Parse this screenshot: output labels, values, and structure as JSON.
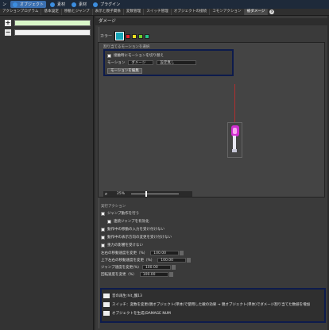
{
  "toolbar": {
    "items": [
      {
        "label": "ン",
        "active": false
      },
      {
        "label": "オブジェクト",
        "active": true
      },
      {
        "label": "素材",
        "active": false
      },
      {
        "label": "素材",
        "active": false
      },
      {
        "label": "プラグイン",
        "active": false
      }
    ]
  },
  "tabs": [
    {
      "label": "アクションプログラム",
      "active": false
    },
    {
      "label": "基本設定",
      "active": false
    },
    {
      "label": "移動とジャンプ",
      "active": false
    },
    {
      "label": "表示と親子関係",
      "active": false
    },
    {
      "label": "変数管理",
      "active": false
    },
    {
      "label": "スイッチ管理",
      "active": false
    },
    {
      "label": "オブジェクトの接続",
      "active": false
    },
    {
      "label": "コモンアクション",
      "active": false
    },
    {
      "label": "被ダメージ",
      "active": true
    }
  ],
  "left_panel": {
    "add_symbol": "+",
    "remove_symbol": "−"
  },
  "main": {
    "header": "ダメージ",
    "color_label": "カラー",
    "colors": [
      "#19a6b8",
      "#e8202a",
      "#f3e021",
      "#6fd12a",
      "#24c48a"
    ],
    "motion_section_title": "割り当てるモーションを選択",
    "motion": {
      "checkbox_label": "接触時にモーションを切り替え",
      "motion_label": "モーション",
      "motion_value": "ダメージ",
      "motion_setting": "設定無し",
      "edit_button": "モーションを編集"
    },
    "zoom": {
      "icon": "magnifier-icon",
      "value": "25%"
    },
    "actions_title": "実行アクション",
    "actions": [
      {
        "type": "check",
        "label": "ジャンプ動作を行う"
      },
      {
        "type": "check",
        "label": "連続ジャンプを有効化",
        "indent": true
      },
      {
        "type": "check",
        "label": "動作中の移動の入力を受け付けない"
      },
      {
        "type": "check",
        "label": "動作中の表示方向の変更を受け付けない"
      },
      {
        "type": "check",
        "label": "重力の影響を受けない"
      },
      {
        "type": "num",
        "label": "左右の移動速度を変更（%）",
        "value": "100.00"
      },
      {
        "type": "num",
        "label": "上下左右の移動速度を変更（%）",
        "value": "100.00"
      },
      {
        "type": "num",
        "label": "ジャンプ速度を変更(%)",
        "value": "100.00"
      },
      {
        "type": "num",
        "label": "回転速度を変更（%）",
        "value": "100.00"
      }
    ],
    "commands": [
      "音の再生:hit_醜13",
      "スイッチ：変数を変更(親オブジェクト(単体)で使用した敵の効果 → 親オブジェクト(単体)でダメージ割り当てた数値を増加",
      "オブジェクトを生成(DAMAGE NUM"
    ]
  }
}
